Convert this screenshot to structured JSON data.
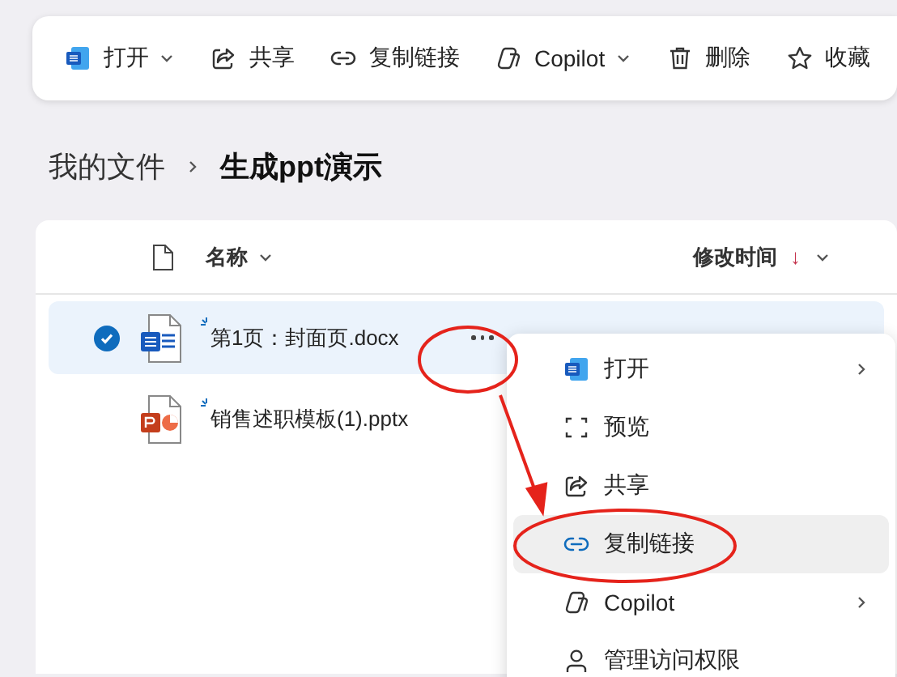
{
  "toolbar": {
    "items": [
      {
        "label": "打开",
        "dropdown": true
      },
      {
        "label": "共享",
        "dropdown": false
      },
      {
        "label": "复制链接",
        "dropdown": false
      },
      {
        "label": "Copilot",
        "dropdown": true
      },
      {
        "label": "删除",
        "dropdown": false
      },
      {
        "label": "收藏",
        "dropdown": false
      }
    ]
  },
  "breadcrumb": [
    {
      "label": "我的文件",
      "current": false
    },
    {
      "label": "生成ppt演示",
      "current": true
    }
  ],
  "file_list": {
    "columns": {
      "name": {
        "label": "名称"
      },
      "modified": {
        "label": "修改时间",
        "sort_indicator": "↓"
      }
    },
    "files": [
      {
        "name": "第1页：封面页.docx",
        "kind": "word",
        "selected": true,
        "new": true
      },
      {
        "name": "销售述职模板(1).pptx",
        "kind": "powerpoint",
        "selected": false,
        "new": true
      }
    ]
  },
  "context_menu": {
    "items": [
      {
        "label": "打开",
        "submenu": true,
        "highlighted": false
      },
      {
        "label": "预览",
        "submenu": false,
        "highlighted": false
      },
      {
        "label": "共享",
        "submenu": false,
        "highlighted": false
      },
      {
        "label": "复制链接",
        "submenu": false,
        "highlighted": true
      },
      {
        "label": "Copilot",
        "submenu": true,
        "highlighted": false
      },
      {
        "label": "管理访问权限",
        "submenu": false,
        "highlighted": false
      }
    ]
  }
}
